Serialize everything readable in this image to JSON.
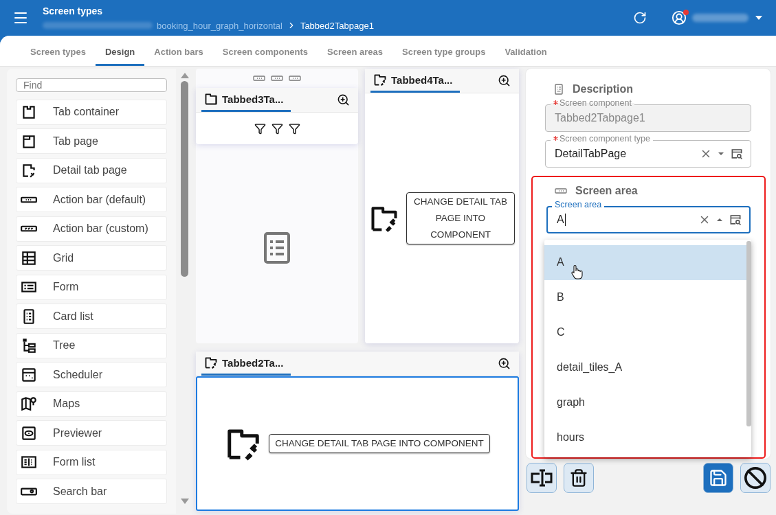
{
  "header": {
    "title": "Screen types",
    "has_notification": true,
    "breadcrumb": [
      {
        "label": "booking_hour_graph_horizontal",
        "current": false
      },
      {
        "label": "Tabbed2Tabpage1",
        "current": true
      }
    ]
  },
  "tabs": [
    {
      "label": "Screen types",
      "selected": false
    },
    {
      "label": "Design",
      "selected": true
    },
    {
      "label": "Action bars",
      "selected": false
    },
    {
      "label": "Screen components",
      "selected": false
    },
    {
      "label": "Screen areas",
      "selected": false
    },
    {
      "label": "Screen type groups",
      "selected": false
    },
    {
      "label": "Validation",
      "selected": false
    }
  ],
  "palette": {
    "search": {
      "placeholder": "Find"
    },
    "items": [
      {
        "label": "Tab container"
      },
      {
        "label": "Tab page"
      },
      {
        "label": "Detail tab page"
      },
      {
        "label": "Action bar (default)"
      },
      {
        "label": "Action bar (custom)"
      },
      {
        "label": "Grid"
      },
      {
        "label": "Form"
      },
      {
        "label": "Card list"
      },
      {
        "label": "Tree"
      },
      {
        "label": "Scheduler"
      },
      {
        "label": "Maps"
      },
      {
        "label": "Previewer"
      },
      {
        "label": "Form list"
      },
      {
        "label": "Search bar"
      }
    ]
  },
  "canvas": {
    "panels": [
      {
        "title": "Tabbed3Ta...",
        "kind": "tab_page",
        "selected": false
      },
      {
        "title": "Tabbed4Ta...",
        "kind": "detail",
        "selected": false,
        "button": "CHANGE DETAIL TAB PAGE INTO COMPONENT"
      },
      {
        "title": "Tabbed2Ta...",
        "kind": "detail",
        "selected": true,
        "button": "CHANGE DETAIL TAB PAGE INTO COMPONENT"
      }
    ]
  },
  "form": {
    "section": "Description",
    "fields": [
      {
        "label": "Screen component",
        "required": true,
        "value": "Tabbed2Tabpage1",
        "disabled": true
      },
      {
        "label": "Screen component type",
        "required": true,
        "value": "DetailTabPage",
        "disabled": false
      }
    ],
    "screen_area": {
      "title": "Screen area",
      "field": {
        "label": "Screen area",
        "value": "A",
        "focused": true
      },
      "options": [
        {
          "label": "A",
          "selected": true
        },
        {
          "label": "B",
          "selected": false
        },
        {
          "label": "C",
          "selected": false
        },
        {
          "label": "detail_tiles_A",
          "selected": false
        },
        {
          "label": "graph",
          "selected": false
        },
        {
          "label": "hours",
          "selected": false
        }
      ]
    }
  }
}
